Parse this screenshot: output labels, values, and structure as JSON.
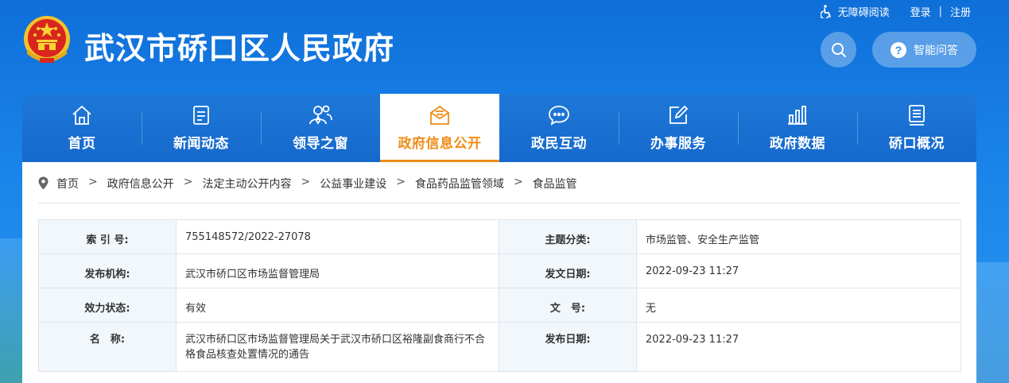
{
  "site": {
    "title": "武汉市硚口区人民政府"
  },
  "toplinks": {
    "accessibility": "无障碍阅读",
    "login": "登录",
    "separator": "|",
    "register": "注册"
  },
  "header": {
    "qa_button": "智能问答",
    "qa_icon_glyph": "?"
  },
  "nav": {
    "items": [
      {
        "label": "首页",
        "icon": "home-icon"
      },
      {
        "label": "新闻动态",
        "icon": "news-icon"
      },
      {
        "label": "领导之窗",
        "icon": "leaders-icon"
      },
      {
        "label": "政府信息公开",
        "icon": "envelope-icon",
        "active": true
      },
      {
        "label": "政民互动",
        "icon": "chat-icon"
      },
      {
        "label": "办事服务",
        "icon": "edit-icon"
      },
      {
        "label": "政府数据",
        "icon": "bar-chart-icon"
      },
      {
        "label": "硚口概况",
        "icon": "document-icon"
      }
    ],
    "active_color": "#ef8c16"
  },
  "breadcrumb": {
    "separator": ">",
    "items": [
      "首页",
      "政府信息公开",
      "法定主动公开内容",
      "公益事业建设",
      "食品药品监管领域",
      "食品监管"
    ]
  },
  "meta": {
    "rows": [
      {
        "k1": "索 引 号:",
        "v1": "755148572/2022-27078",
        "k2": "主题分类:",
        "v2": "市场监管、安全生产监管"
      },
      {
        "k1": "发布机构:",
        "v1": "武汉市硚口区市场监督管理局",
        "k2": "发文日期:",
        "v2": "2022-09-23 11:27"
      },
      {
        "k1": "效力状态:",
        "v1": "有效",
        "k2": "文　号:",
        "v2": "无"
      },
      {
        "k1": "名　称:",
        "v1": "武汉市硚口区市场监督管理局关于武汉市硚口区裕隆副食商行不合格食品核查处置情况的通告",
        "k2": "发布日期:",
        "v2": "2022-09-23 11:27"
      }
    ]
  }
}
